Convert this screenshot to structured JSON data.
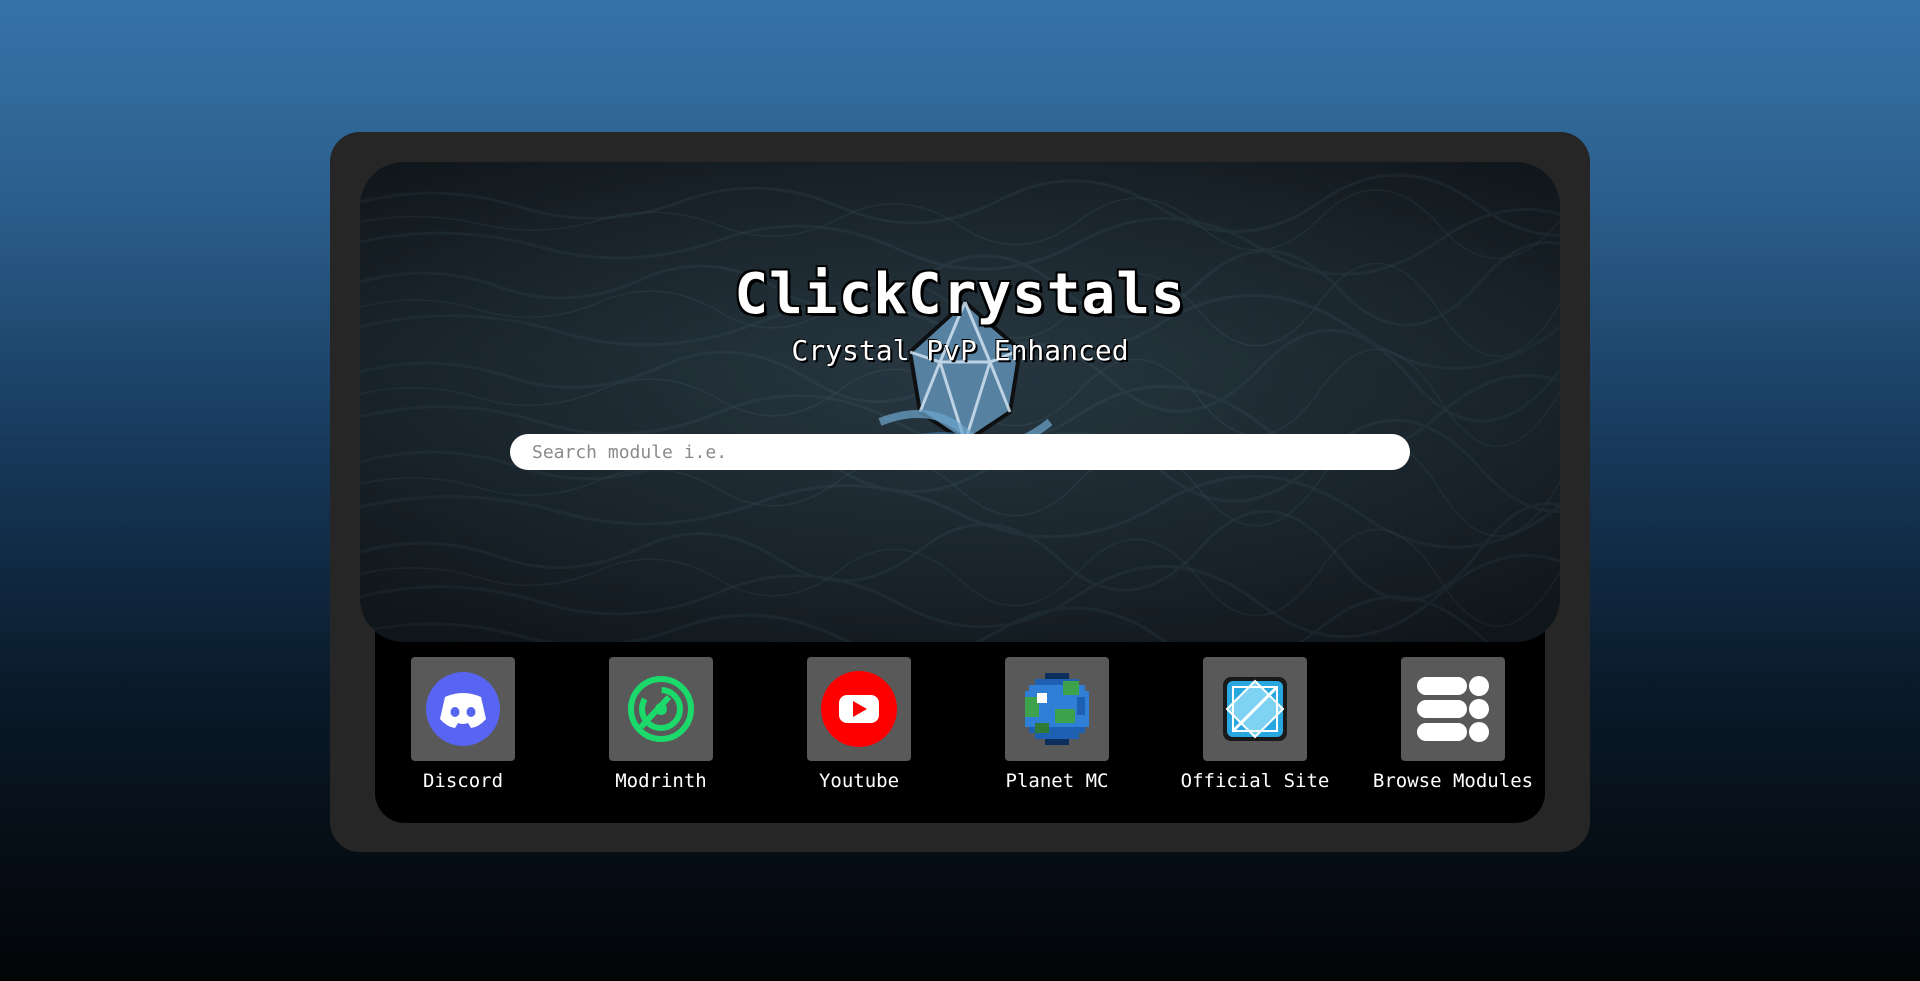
{
  "header": {
    "title": "ClickCrystals",
    "subtitle": "Crystal PvP Enhanced"
  },
  "search": {
    "placeholder": "Search module i.e.",
    "value": ""
  },
  "links": [
    {
      "label": "Discord",
      "icon": "discord-icon",
      "color": "#5865f2"
    },
    {
      "label": "Modrinth",
      "icon": "modrinth-icon",
      "color": "#1bd96a"
    },
    {
      "label": "Youtube",
      "icon": "youtube-icon",
      "color": "#ff0000"
    },
    {
      "label": "Planet MC",
      "icon": "planet-mc-icon",
      "color": "#2f7fd6"
    },
    {
      "label": "Official Site",
      "icon": "crystal-site-icon",
      "color": "#29a8e0"
    },
    {
      "label": "Browse Modules",
      "icon": "modules-list-icon",
      "color": "#ffffff"
    }
  ]
}
